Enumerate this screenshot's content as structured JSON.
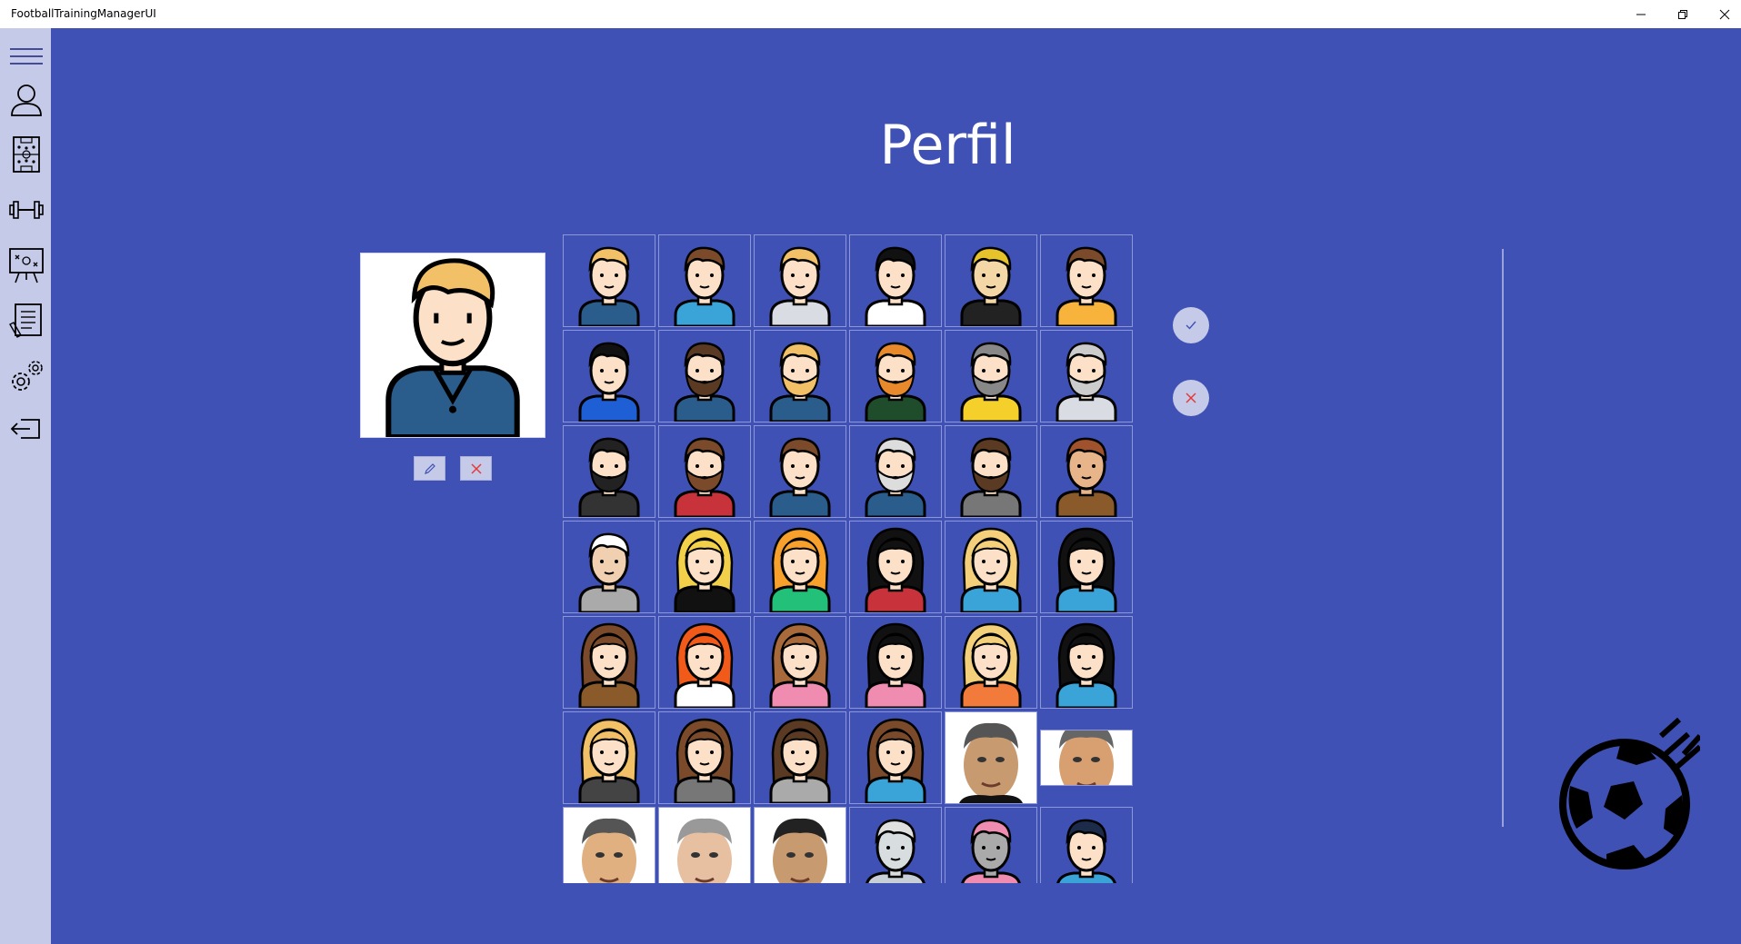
{
  "window": {
    "title": "FootballTrainingManagerUI"
  },
  "sidebar": {
    "items": [
      {
        "icon": "hamburger-menu-icon"
      },
      {
        "icon": "user-profile-icon"
      },
      {
        "icon": "tactics-board-icon"
      },
      {
        "icon": "dumbbell-icon"
      },
      {
        "icon": "presentation-board-icon"
      },
      {
        "icon": "notes-document-icon"
      },
      {
        "icon": "settings-gears-icon"
      },
      {
        "icon": "logout-icon"
      }
    ]
  },
  "page": {
    "title": "Perfil"
  },
  "avatar_grid": {
    "rows": 7,
    "columns": 6,
    "visible_rows_fully": 6
  },
  "colors": {
    "background": "#3f51b5",
    "sidebar": "#c5cae9",
    "accept": "#3f51b5",
    "cancel": "#e53935"
  }
}
